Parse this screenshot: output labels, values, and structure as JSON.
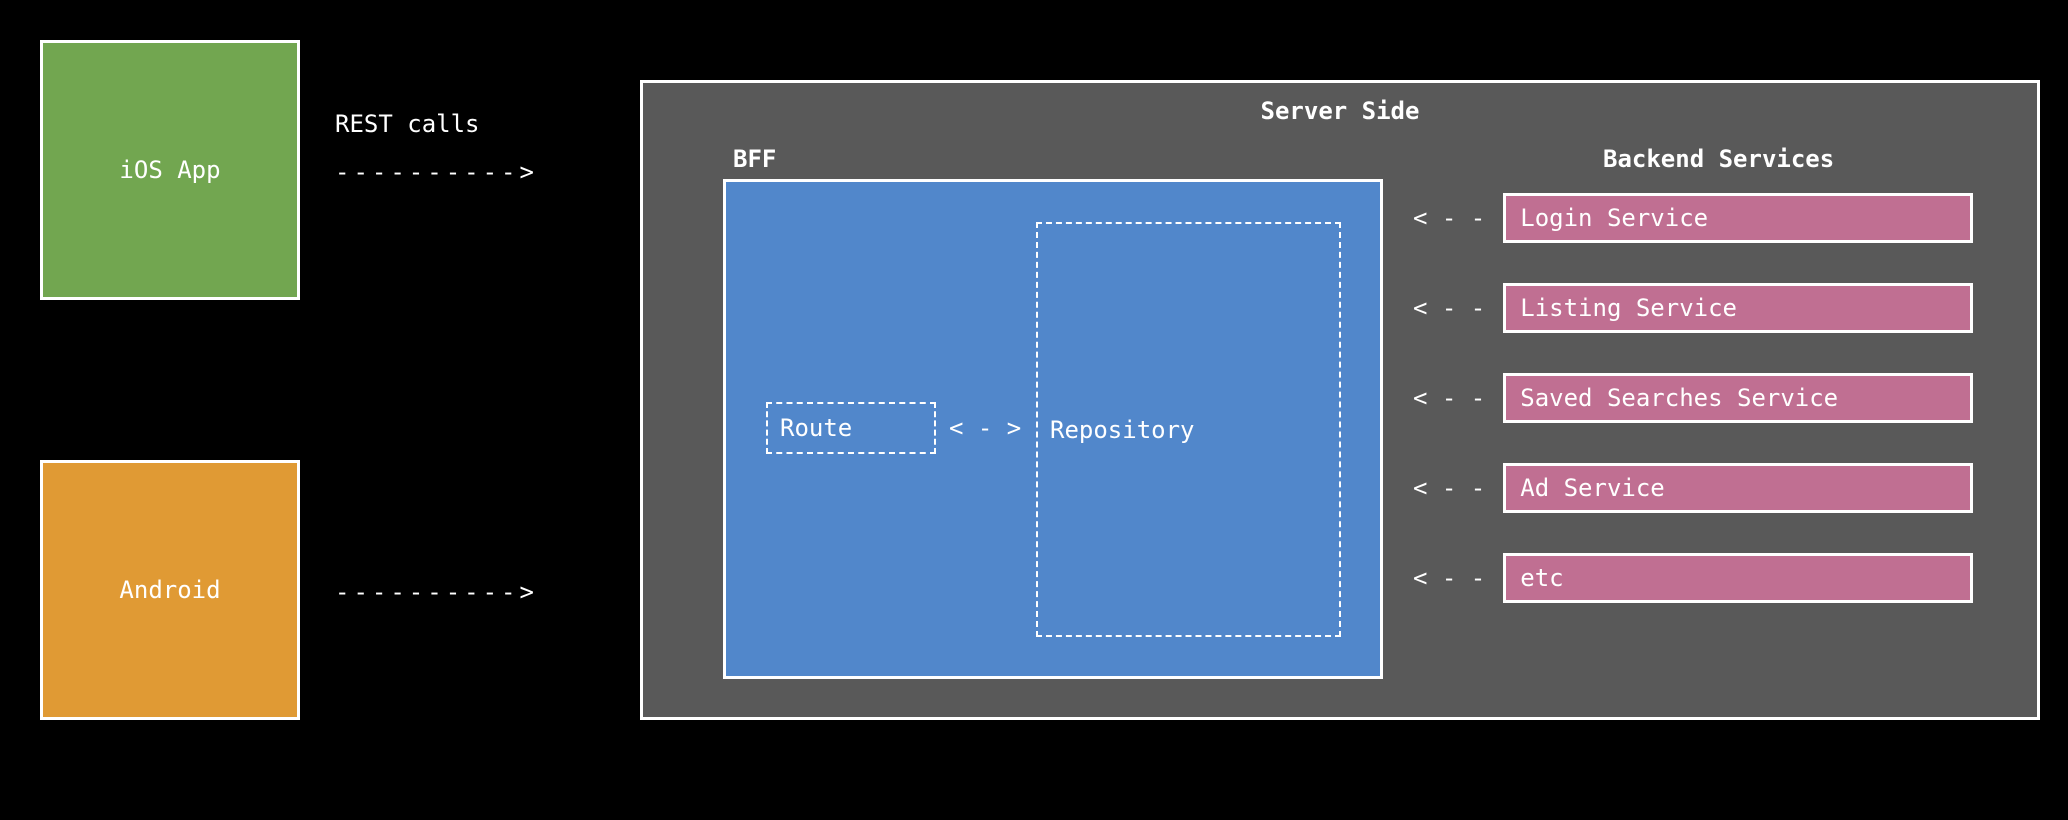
{
  "clients": {
    "ios_label": "iOS App",
    "android_label": "Android"
  },
  "rest_calls_label": "REST calls",
  "client_to_server_arrow": "---------->",
  "server": {
    "title": "Server Side",
    "bff": {
      "label": "BFF",
      "route_label": "Route",
      "repository_label": "Repository",
      "route_repo_arrow": "< - >"
    },
    "backend": {
      "title": "Backend Services",
      "service_arrow": "< - -",
      "services": [
        "Login Service",
        "Listing Service",
        "Saved Searches Service",
        "Ad Service",
        "etc"
      ]
    }
  }
}
